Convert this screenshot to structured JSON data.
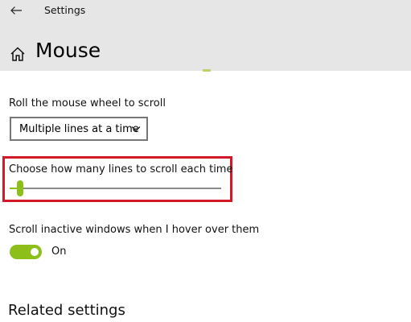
{
  "window": {
    "title": "Settings",
    "back_icon": "back-arrow-icon"
  },
  "header": {
    "home_icon": "home-icon",
    "page_title": "Mouse"
  },
  "scroll": {
    "roll_label": "Roll the mouse wheel to scroll",
    "roll_dropdown": {
      "selected": "Multiple lines at a time",
      "chevron_icon": "chevron-down-icon"
    },
    "lines_label": "Choose how many lines to scroll each time",
    "lines_slider": {
      "value_fraction": 0.05
    },
    "highlight_color": "#d2192a"
  },
  "inactive_scroll": {
    "label": "Scroll inactive windows when I hover over them",
    "toggle_state": "On",
    "toggle_on": true
  },
  "related": {
    "heading": "Related settings"
  },
  "colors": {
    "accent": "#8dbf1a",
    "header_bg": "#e6e6e6"
  }
}
